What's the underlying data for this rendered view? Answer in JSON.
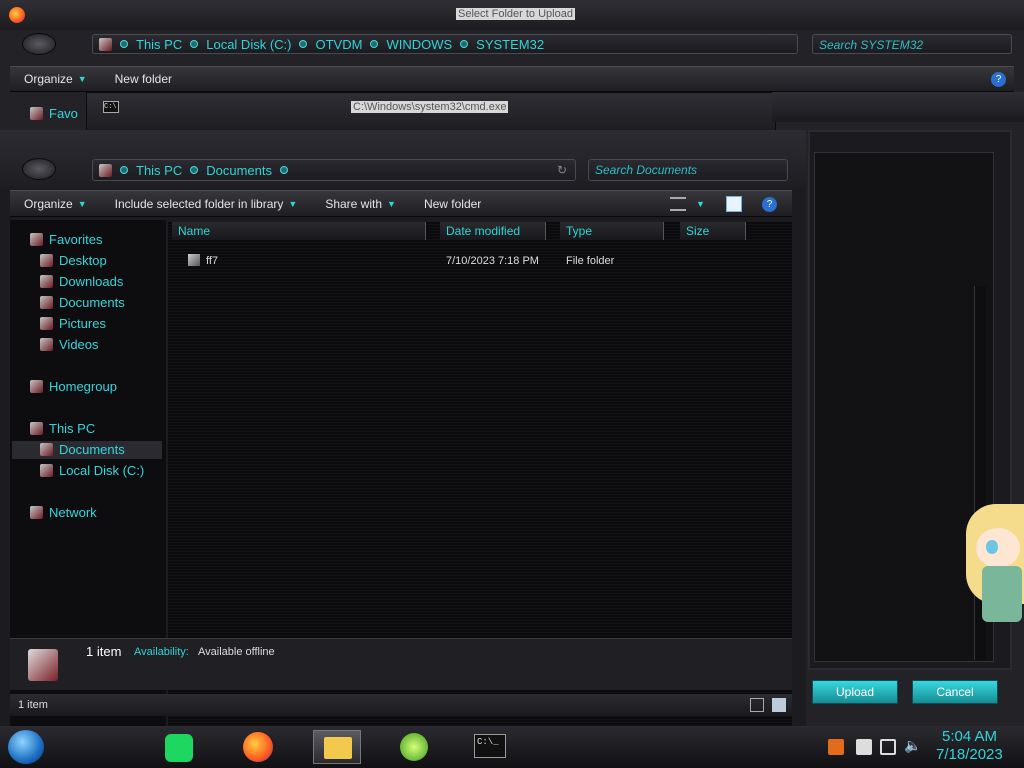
{
  "back_window": {
    "title": "Select Folder to Upload",
    "breadcrumbs": [
      "This PC",
      "Local Disk (C:)",
      "OTVDM",
      "WINDOWS",
      "SYSTEM32"
    ],
    "search_placeholder": "Search SYSTEM32",
    "toolbar": {
      "organize": "Organize",
      "new_folder": "New folder"
    },
    "nav_partial": "Favo",
    "upload_label": "Upload",
    "cancel_label": "Cancel"
  },
  "cmd_window": {
    "title": "C:\\Windows\\system32\\cmd.exe"
  },
  "front_window": {
    "breadcrumbs": [
      "This PC",
      "Documents"
    ],
    "search_placeholder": "Search Documents",
    "toolbar": {
      "organize": "Organize",
      "include": "Include selected folder in library",
      "share": "Share with",
      "new_folder": "New folder"
    },
    "nav": {
      "favorites": "Favorites",
      "desktop": "Desktop",
      "downloads": "Downloads",
      "documents": "Documents",
      "pictures": "Pictures",
      "videos": "Videos",
      "homegroup": "Homegroup",
      "this_pc": "This PC",
      "pc_documents": "Documents",
      "local_disk": "Local Disk (C:)",
      "network": "Network"
    },
    "columns": {
      "name": "Name",
      "date": "Date modified",
      "type": "Type",
      "size": "Size"
    },
    "files": [
      {
        "name": "ff7",
        "date": "7/10/2023 7:18 PM",
        "type": "File folder",
        "size": ""
      }
    ],
    "details": {
      "count": "1 item",
      "availability_label": "Availability:",
      "availability_value": "Available offline"
    },
    "status_count": "1 item"
  },
  "taskbar": {
    "time": "5:04 AM",
    "date": "7/18/2023",
    "cmd_label": "C:\\_"
  },
  "colors": {
    "accent": "#2fd6d6",
    "bg": "#1a1a1e"
  }
}
